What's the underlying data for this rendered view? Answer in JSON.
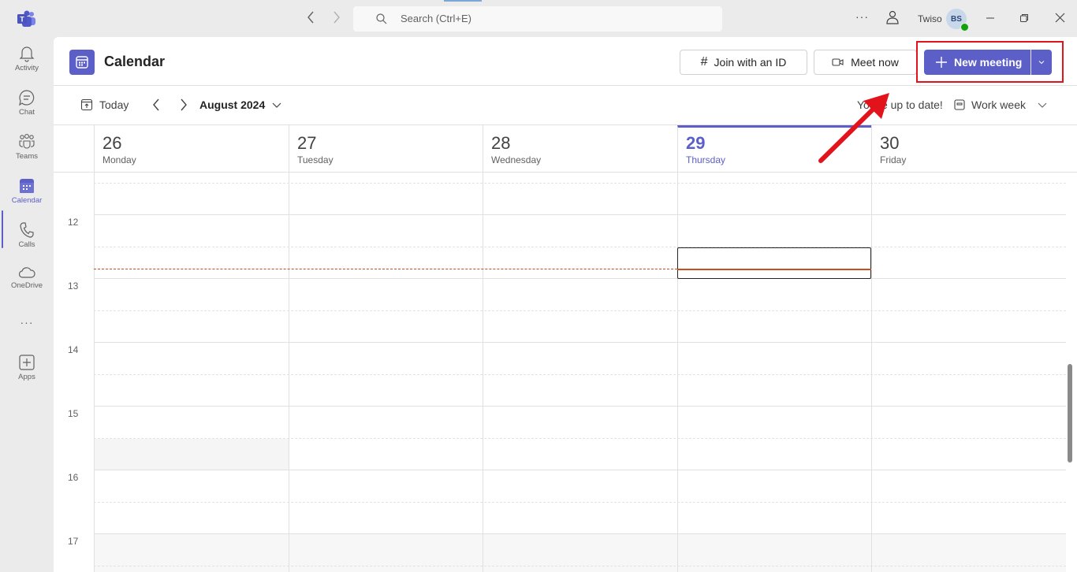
{
  "titlebar": {
    "search_placeholder": "Search (Ctrl+E)",
    "org_name": "Twiso",
    "avatar_initials": "BS",
    "presence_status": "available"
  },
  "rail": {
    "items": [
      {
        "label": "Activity",
        "icon": "bell-icon"
      },
      {
        "label": "Chat",
        "icon": "chat-icon"
      },
      {
        "label": "Teams",
        "icon": "teams-icon"
      },
      {
        "label": "Calendar",
        "icon": "calendar-icon",
        "active": true
      },
      {
        "label": "Calls",
        "icon": "phone-icon"
      },
      {
        "label": "OneDrive",
        "icon": "cloud-icon"
      },
      {
        "label": "Apps",
        "icon": "add-app-icon"
      }
    ]
  },
  "header": {
    "title": "Calendar",
    "join_label": "Join with an ID",
    "meet_now_label": "Meet now",
    "new_meeting_label": "New meeting"
  },
  "toolbar": {
    "today_label": "Today",
    "month_label": "August 2024",
    "status_text": "You're up to date!",
    "view_label": "Work week"
  },
  "days": [
    {
      "num": "26",
      "name": "Monday"
    },
    {
      "num": "27",
      "name": "Tuesday"
    },
    {
      "num": "28",
      "name": "Wednesday"
    },
    {
      "num": "29",
      "name": "Thursday",
      "today": true
    },
    {
      "num": "30",
      "name": "Friday"
    }
  ],
  "hours": [
    "12",
    "13",
    "14",
    "15",
    "16",
    "17"
  ],
  "colors": {
    "accent": "#5b5fc7",
    "now_indicator": "#c4501d",
    "annotation": "#e3131b"
  }
}
